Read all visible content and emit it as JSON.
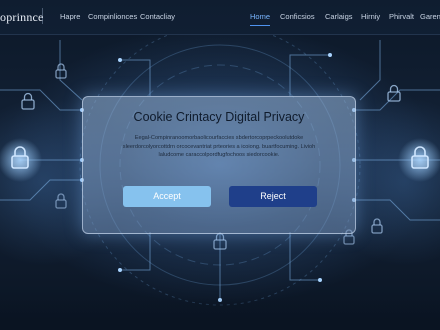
{
  "nav": {
    "brand": "oprinnce",
    "left_links": [
      "Hapre",
      "Compinlionces",
      "Contacliay"
    ],
    "right_links": [
      "Home",
      "Conficsios",
      "Carlaigs",
      "Hirniy",
      "Phirvalt",
      "Garen"
    ],
    "active": "Home"
  },
  "modal": {
    "title": "Cookie Crintacy Digital Privacy",
    "body_lines": [
      "Eegal-Compinranoomorbaolicourfaccies sbdertorcoprpeckoolutdoke",
      "sleerdorcolyorcottdrn orcocevantriat prteories a icoiong. buartfocuming. Livioh",
      "laludcome caraccolpordfugfochoos siedorcookie."
    ],
    "accept_label": "Accept",
    "reject_label": "Reject"
  },
  "colors": {
    "accent": "#4f93f0",
    "accept_button": "#86c2ee",
    "reject_button": "#1f3f8a",
    "background": "#0a1422"
  },
  "icons": [
    "lock-icon"
  ]
}
